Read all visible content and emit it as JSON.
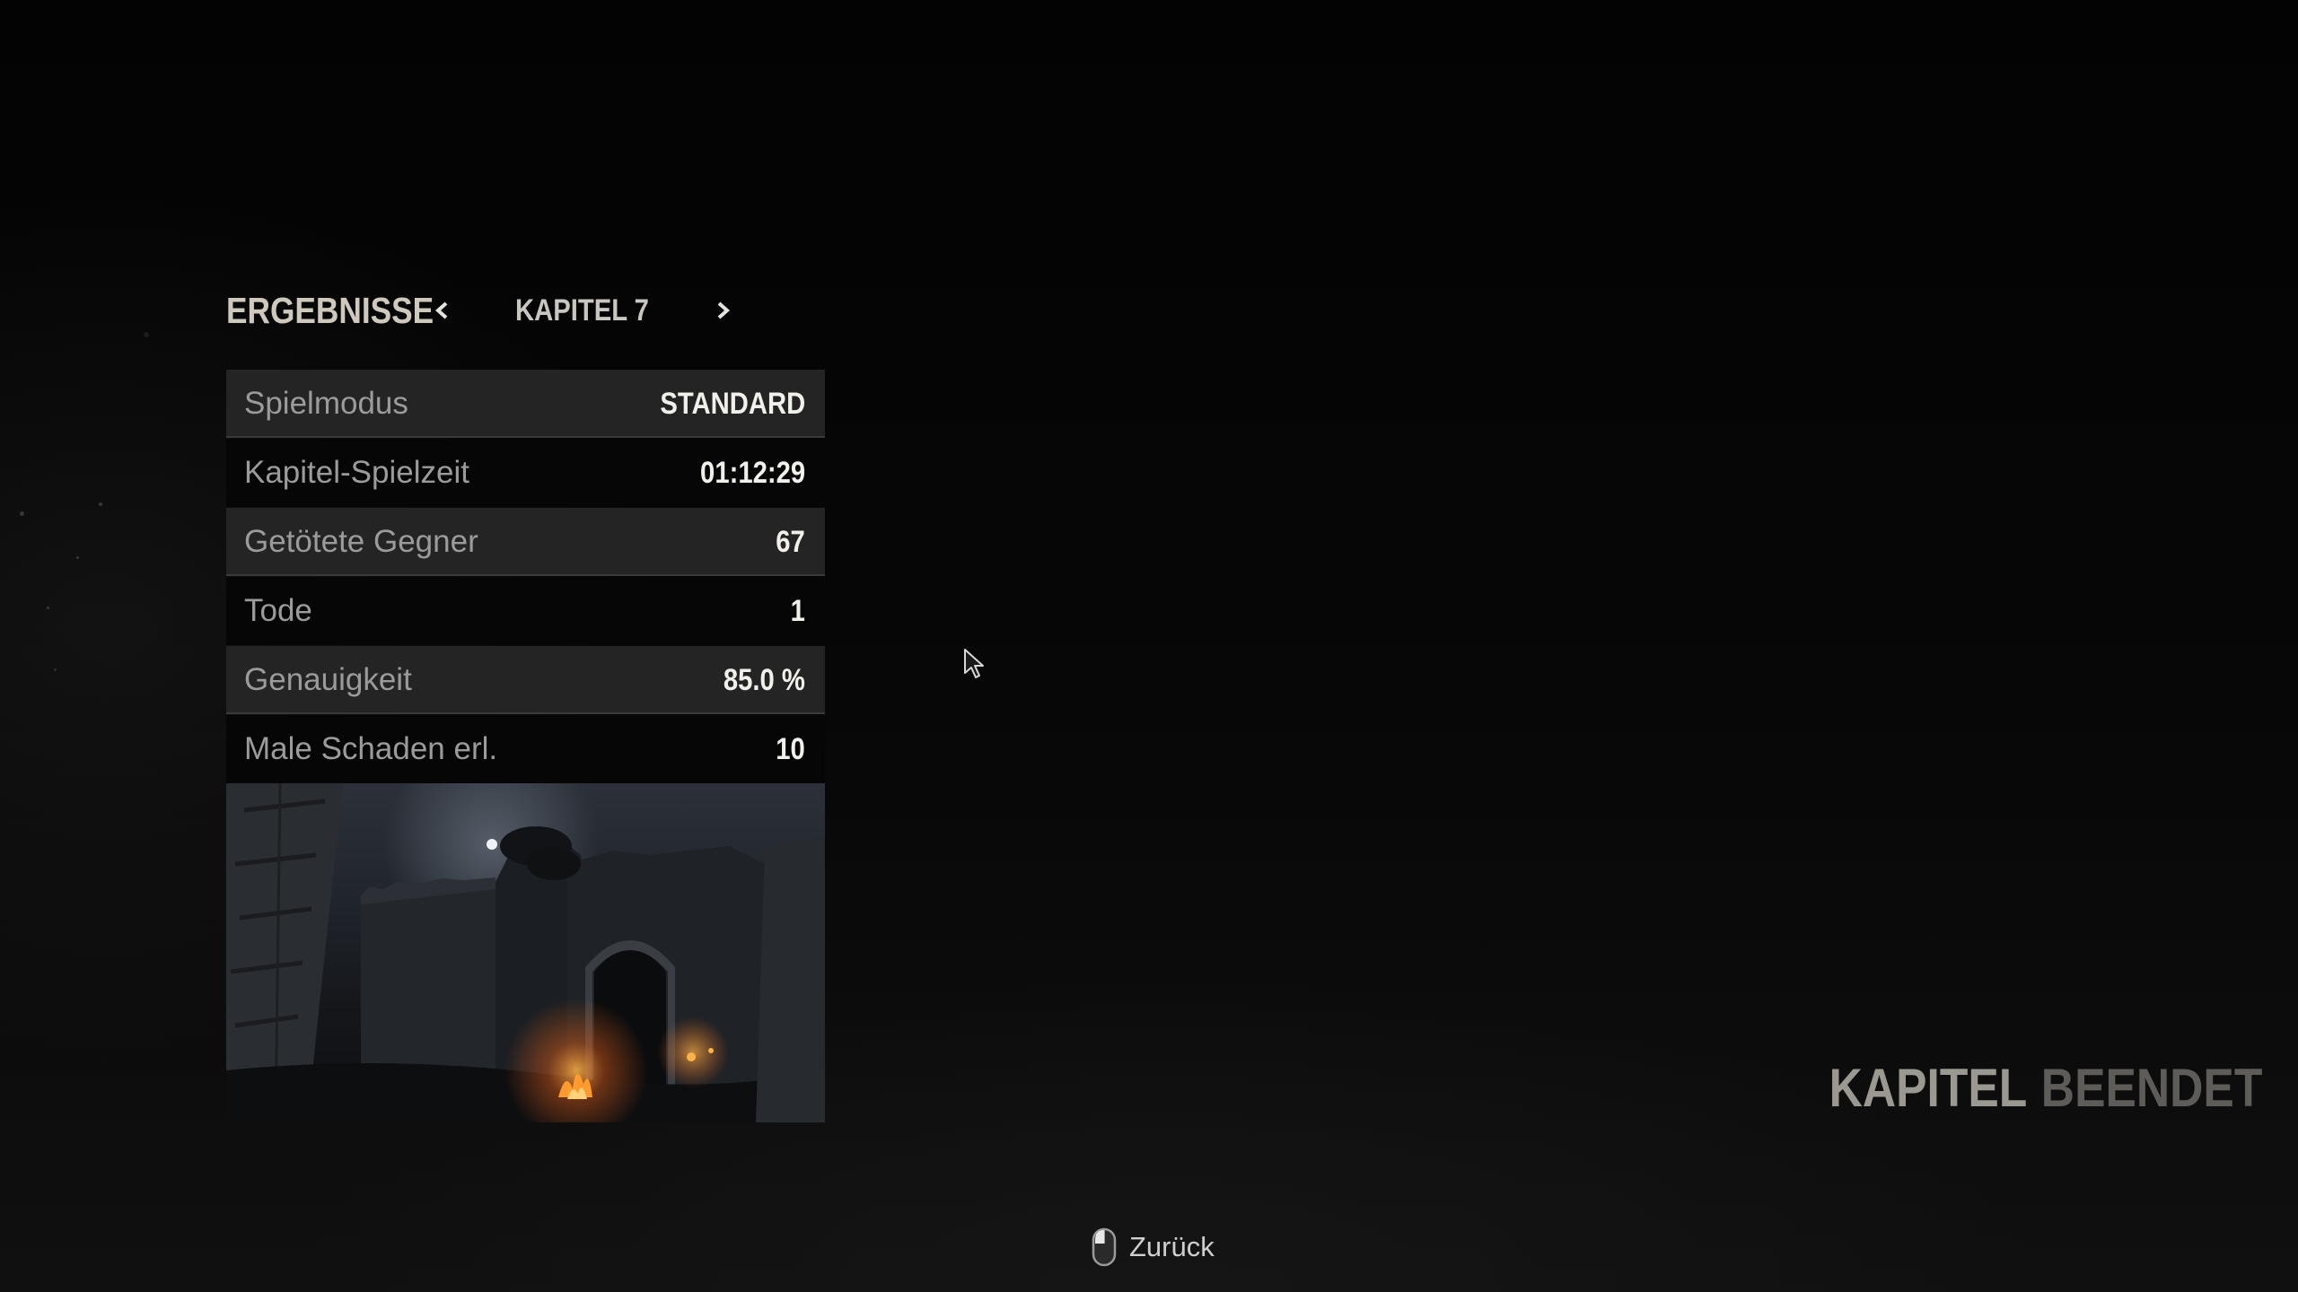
{
  "header": {
    "title": "ERGEBNISSE",
    "chapter_label": "KAPITEL 7",
    "prev_icon": "chevron-left-icon",
    "next_icon": "chevron-right-icon"
  },
  "stats": [
    {
      "label": "Spielmodus",
      "value": "STANDARD"
    },
    {
      "label": "Kapitel-Spielzeit",
      "value": "01:12:29"
    },
    {
      "label": "Getötete Gegner",
      "value": "67"
    },
    {
      "label": "Tode",
      "value": "1"
    },
    {
      "label": "Genauigkeit",
      "value": "85.0 %"
    },
    {
      "label": "Male Schaden erl.",
      "value": "10"
    }
  ],
  "status": {
    "word1": "KAPITEL",
    "word2": "BEENDET"
  },
  "footer": {
    "back_label": "Zurück",
    "back_icon": "mouse-icon"
  },
  "colors": {
    "background": "#050505",
    "row_shade": "#242424",
    "value_text": "#f2f0ea",
    "label_text": "#9b9b9b",
    "fire": "#ff8a1e"
  }
}
